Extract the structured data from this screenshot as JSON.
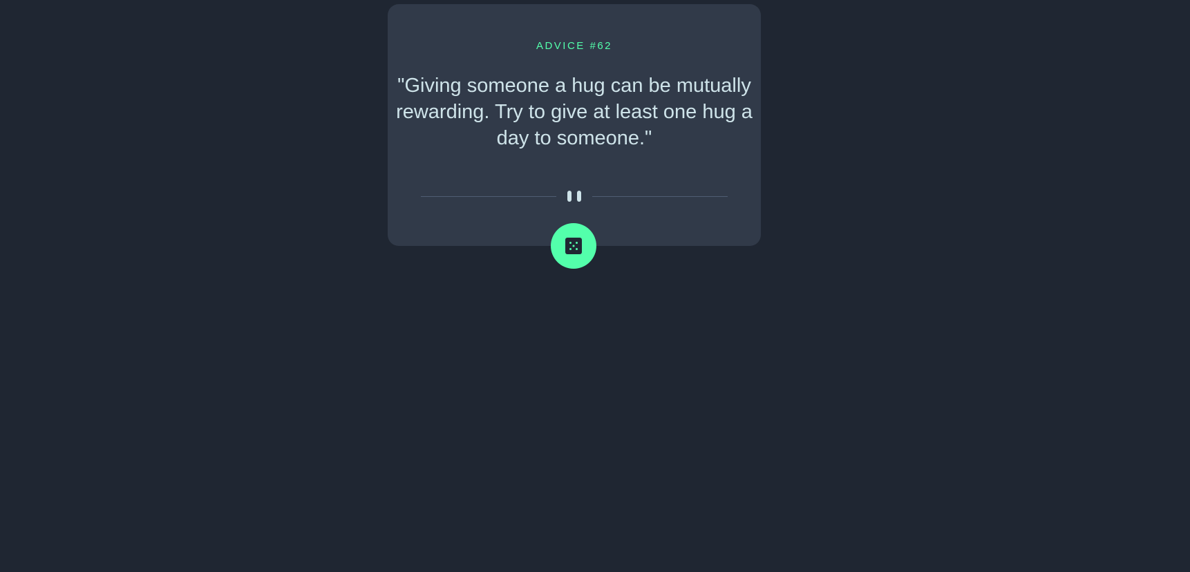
{
  "card": {
    "advice_label": "ADVICE #62",
    "advice_text": "\"Giving someone a hug can be mutually rewarding. Try to give at least one hug a day to someone.\""
  },
  "icons": {
    "divider": "pause-icon",
    "button": "dice-icon"
  },
  "colors": {
    "background": "#1f2632",
    "card": "#313a49",
    "accent": "#53ffab",
    "text": "#cee3e9",
    "divider_line": "#4f5d74"
  }
}
